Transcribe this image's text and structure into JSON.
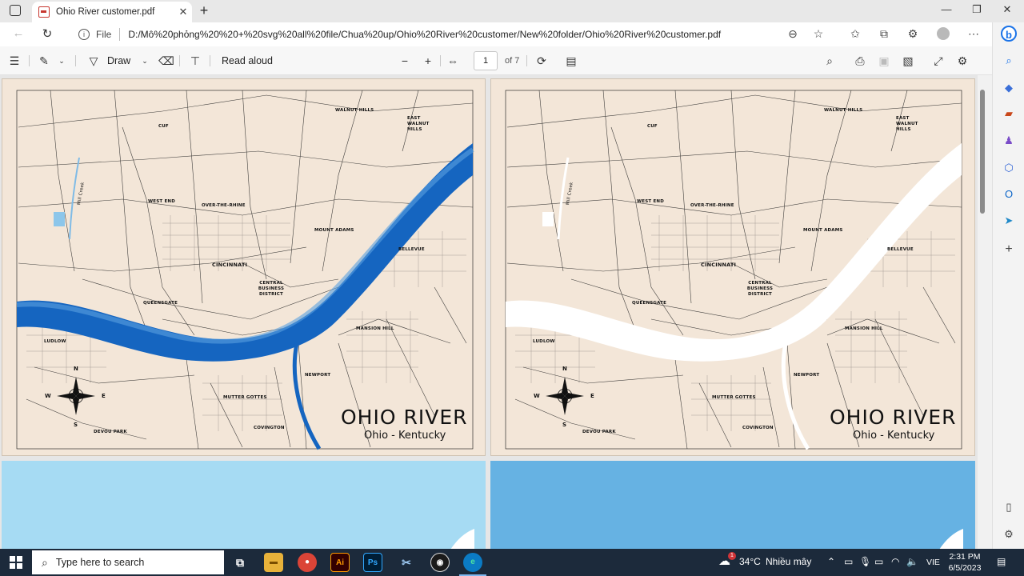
{
  "browser": {
    "tab_title": "Ohio River customer.pdf",
    "url_scheme_label": "File",
    "url": "D:/Mô%20phỏng%20%20+%20svg%20all%20file/Chua%20up/Ohio%20River%20customer/New%20folder/Ohio%20River%20customer.pdf"
  },
  "pdf_toolbar": {
    "draw_label": "Draw",
    "read_aloud_label": "Read aloud",
    "page_number": "1",
    "page_total": "of 7"
  },
  "maps": [
    {
      "title": "OHIO RIVER",
      "subtitle": "Ohio - Kentucky",
      "river_color": "#1565c0",
      "places": [
        "WALNUT HILLS",
        "EAST WALNUT HILLS",
        "CUF",
        "WEST END",
        "OVER-THE-RHINE",
        "MOUNT ADAMS",
        "BELLEVUE",
        "CINCINNATI",
        "CENTRAL BUSINESS DISTRICT",
        "QUEENSGATE",
        "MANSION HILL",
        "LUDLOW",
        "NEWPORT",
        "MUTTER GOTTES",
        "COVINGTON",
        "DEVOU PARK",
        "Mill Creek"
      ],
      "compass": [
        "N",
        "E",
        "S",
        "W"
      ]
    },
    {
      "title": "OHIO RIVER",
      "subtitle": "Ohio - Kentucky",
      "river_color": "#ffffff",
      "places": [
        "WALNUT HILLS",
        "EAST WALNUT HILLS",
        "CUF",
        "WEST END",
        "OVER-THE-RHINE",
        "MOUNT ADAMS",
        "BELLEVUE",
        "CINCINNATI",
        "CENTRAL BUSINESS DISTRICT",
        "QUEENSGATE",
        "MANSION HILL",
        "LUDLOW",
        "NEWPORT",
        "MUTTER GOTTES",
        "COVINGTON",
        "DEVOU PARK",
        "Mill Creek"
      ],
      "compass": [
        "N",
        "E",
        "S",
        "W"
      ]
    }
  ],
  "taskbar": {
    "search_placeholder": "Type here to search",
    "weather_temp": "34°C",
    "weather_desc": "Nhiều mây",
    "weather_badge": "1",
    "language": "VIE",
    "time": "2:31 PM",
    "date": "6/5/2023",
    "apps": [
      "file-explorer",
      "chrome",
      "illustrator",
      "photoshop",
      "snipping",
      "obs",
      "edge"
    ]
  },
  "colors": {
    "map_background": "#f3e6d8",
    "page3_background": "#a6dbf3",
    "page4_background": "#66b2e3"
  }
}
